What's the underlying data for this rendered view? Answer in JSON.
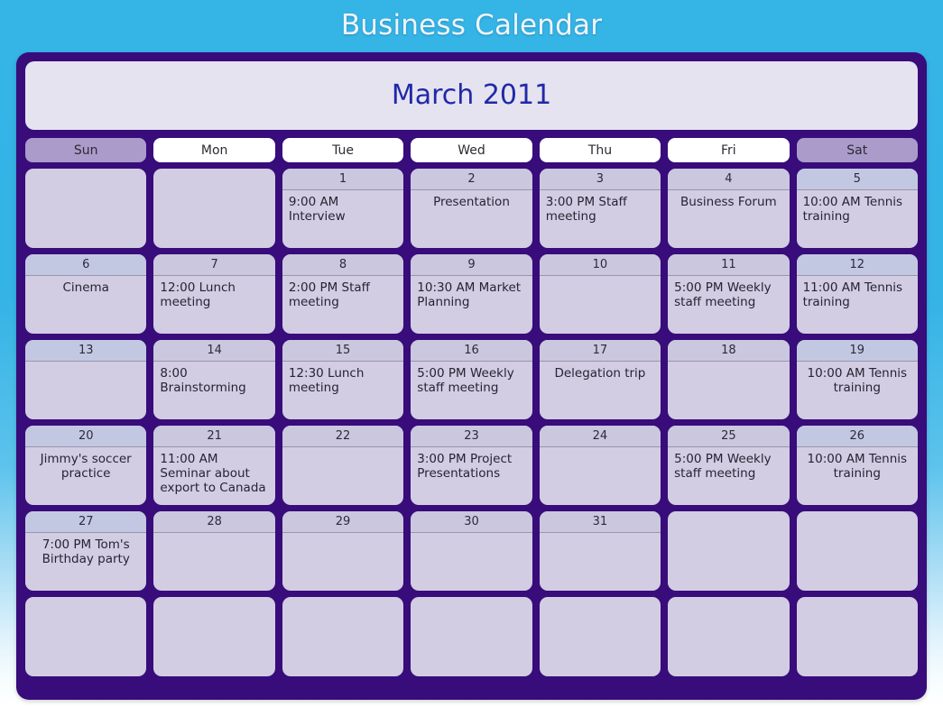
{
  "app": {
    "title": "Business Calendar"
  },
  "calendar": {
    "month_label": "March 2011",
    "weekday_headers": [
      {
        "label": "Sun",
        "weekend": true
      },
      {
        "label": "Mon",
        "weekend": false
      },
      {
        "label": "Tue",
        "weekend": false
      },
      {
        "label": "Wed",
        "weekend": false
      },
      {
        "label": "Thu",
        "weekend": false
      },
      {
        "label": "Fri",
        "weekend": false
      },
      {
        "label": "Sat",
        "weekend": true
      }
    ],
    "colors": {
      "page_background_top": "#35b4e6",
      "page_background_bottom": "#ffffff",
      "frame": "#380c7a",
      "month_banner": "#e6e3f0",
      "month_text": "#2029a8",
      "weekday_pill": "#ffffff",
      "weekend_pill": "#ab9bcb",
      "day_cell": "#d2cde2",
      "day_number_band": "#cbc7de",
      "day_number_band_weekend": "#c3c8e2",
      "day_text": "#262433",
      "title_text": "#f0f4f8"
    },
    "weeks": [
      [
        {
          "day": "",
          "event": "",
          "align": "left",
          "weekend": true,
          "blank": true
        },
        {
          "day": "",
          "event": "",
          "align": "left",
          "weekend": false,
          "blank": true
        },
        {
          "day": "1",
          "event": "9:00 AM Interview",
          "align": "left",
          "weekend": false,
          "blank": false
        },
        {
          "day": "2",
          "event": "Presentation",
          "align": "center",
          "weekend": false,
          "blank": false
        },
        {
          "day": "3",
          "event": "3:00 PM Staff meeting",
          "align": "left",
          "weekend": false,
          "blank": false
        },
        {
          "day": "4",
          "event": "Business Forum",
          "align": "center",
          "weekend": false,
          "blank": false
        },
        {
          "day": "5",
          "event": "10:00 AM Tennis training",
          "align": "left",
          "weekend": true,
          "blank": false
        }
      ],
      [
        {
          "day": "6",
          "event": "Cinema",
          "align": "center",
          "weekend": true,
          "blank": false
        },
        {
          "day": "7",
          "event": "12:00 Lunch meeting",
          "align": "left",
          "weekend": false,
          "blank": false
        },
        {
          "day": "8",
          "event": "2:00 PM Staff meeting",
          "align": "left",
          "weekend": false,
          "blank": false
        },
        {
          "day": "9",
          "event": "10:30 AM Market Planning",
          "align": "left",
          "weekend": false,
          "blank": false
        },
        {
          "day": "10",
          "event": "",
          "align": "left",
          "weekend": false,
          "blank": false
        },
        {
          "day": "11",
          "event": "5:00 PM Weekly staff meeting",
          "align": "left",
          "weekend": false,
          "blank": false
        },
        {
          "day": "12",
          "event": "11:00 AM Tennis training",
          "align": "left",
          "weekend": true,
          "blank": false
        }
      ],
      [
        {
          "day": "13",
          "event": "",
          "align": "left",
          "weekend": true,
          "blank": false
        },
        {
          "day": "14",
          "event": "8:00 Brainstorming",
          "align": "left",
          "weekend": false,
          "blank": false
        },
        {
          "day": "15",
          "event": "12:30 Lunch meeting",
          "align": "left",
          "weekend": false,
          "blank": false
        },
        {
          "day": "16",
          "event": "5:00 PM Weekly staff meeting",
          "align": "left",
          "weekend": false,
          "blank": false
        },
        {
          "day": "17",
          "event": "Delegation trip",
          "align": "center",
          "weekend": false,
          "blank": false
        },
        {
          "day": "18",
          "event": "",
          "align": "left",
          "weekend": false,
          "blank": false
        },
        {
          "day": "19",
          "event": "10:00 AM Tennis training",
          "align": "center",
          "weekend": true,
          "blank": false
        }
      ],
      [
        {
          "day": "20",
          "event": "Jimmy's soccer practice",
          "align": "center",
          "weekend": true,
          "blank": false
        },
        {
          "day": "21",
          "event": "11:00 AM Seminar about export to Canada",
          "align": "left",
          "weekend": false,
          "blank": false
        },
        {
          "day": "22",
          "event": "",
          "align": "left",
          "weekend": false,
          "blank": false
        },
        {
          "day": "23",
          "event": "3:00 PM Project Presentations",
          "align": "left",
          "weekend": false,
          "blank": false
        },
        {
          "day": "24",
          "event": "",
          "align": "left",
          "weekend": false,
          "blank": false
        },
        {
          "day": "25",
          "event": "5:00 PM Weekly staff meeting",
          "align": "left",
          "weekend": false,
          "blank": false
        },
        {
          "day": "26",
          "event": "10:00 AM Tennis training",
          "align": "center",
          "weekend": true,
          "blank": false
        }
      ],
      [
        {
          "day": "27",
          "event": "7:00 PM Tom's Birthday party",
          "align": "center",
          "weekend": true,
          "blank": false
        },
        {
          "day": "28",
          "event": "",
          "align": "left",
          "weekend": false,
          "blank": false
        },
        {
          "day": "29",
          "event": "",
          "align": "left",
          "weekend": false,
          "blank": false
        },
        {
          "day": "30",
          "event": "",
          "align": "left",
          "weekend": false,
          "blank": false
        },
        {
          "day": "31",
          "event": "",
          "align": "left",
          "weekend": false,
          "blank": false
        },
        {
          "day": "",
          "event": "",
          "align": "left",
          "weekend": false,
          "blank": true
        },
        {
          "day": "",
          "event": "",
          "align": "left",
          "weekend": true,
          "blank": true
        }
      ],
      [
        {
          "day": "",
          "event": "",
          "align": "left",
          "weekend": true,
          "blank": true
        },
        {
          "day": "",
          "event": "",
          "align": "left",
          "weekend": false,
          "blank": true
        },
        {
          "day": "",
          "event": "",
          "align": "left",
          "weekend": false,
          "blank": true
        },
        {
          "day": "",
          "event": "",
          "align": "left",
          "weekend": false,
          "blank": true
        },
        {
          "day": "",
          "event": "",
          "align": "left",
          "weekend": false,
          "blank": true
        },
        {
          "day": "",
          "event": "",
          "align": "left",
          "weekend": false,
          "blank": true
        },
        {
          "day": "",
          "event": "",
          "align": "left",
          "weekend": true,
          "blank": true
        }
      ]
    ]
  }
}
